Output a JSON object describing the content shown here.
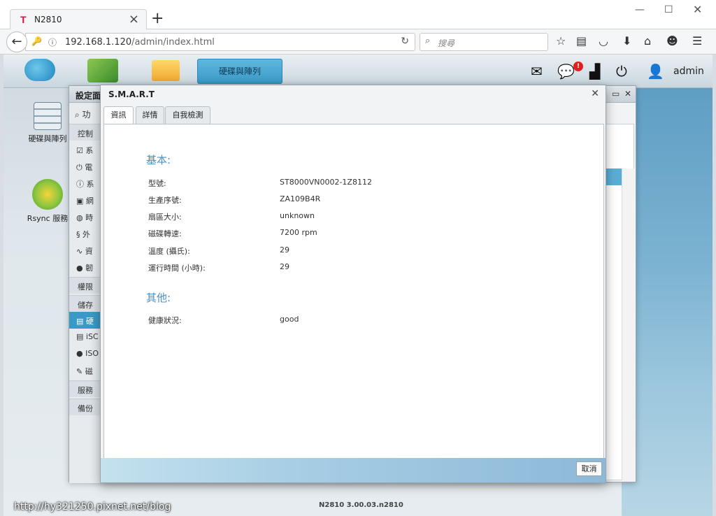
{
  "browser": {
    "tab_title": "N2810",
    "tab_favicon": "T",
    "url_host": "192.168.1.120",
    "url_path": "/admin/index.html",
    "search_placeholder": "搜尋",
    "icons": [
      "back-icon",
      "key-icon",
      "info-icon",
      "reload-icon",
      "search-icon",
      "bookmark-star-icon",
      "reading-list-icon",
      "pocket-icon",
      "download-icon",
      "home-icon",
      "smiley-icon",
      "hamburger-menu-icon"
    ]
  },
  "nas": {
    "top_tab_label": "硬碟與陣列",
    "user": "admin",
    "notification_badge": "!",
    "desktop_icons": [
      {
        "label": "硬碟與陣列"
      },
      {
        "label": "Rsync 服務"
      }
    ],
    "settings_window": {
      "title": "設定面",
      "search_hint": "功",
      "sections": {
        "control": "控制",
        "permission": "權限",
        "storage": "儲存",
        "service": "服務",
        "backup": "備份"
      },
      "items": [
        "系",
        "電",
        "系",
        "網",
        "時",
        "外",
        "資",
        "韌",
        "硬",
        "iSC",
        "ISO",
        "磁"
      ]
    },
    "watermark": "http://hy321250.pixnet.net/blog",
    "version": "N2810 3.00.03.n2810"
  },
  "dialog": {
    "title": "S.M.A.R.T",
    "tabs": [
      "資訊",
      "詳情",
      "自我檢測"
    ],
    "basic_title": "基本:",
    "basic": [
      {
        "label": "型號:",
        "value": "ST8000VN0002-1Z8112"
      },
      {
        "label": "生產序號:",
        "value": "ZA109B4R"
      },
      {
        "label": "扇區大小:",
        "value": "unknown"
      },
      {
        "label": "磁碟轉速:",
        "value": "7200 rpm"
      },
      {
        "label": "溫度 (攝氏):",
        "value": "29"
      },
      {
        "label": "運行時間 (小時):",
        "value": "29"
      }
    ],
    "other_title": "其他:",
    "other": [
      {
        "label": "健康狀況:",
        "value": "good"
      }
    ],
    "cancel_label": "取消"
  }
}
